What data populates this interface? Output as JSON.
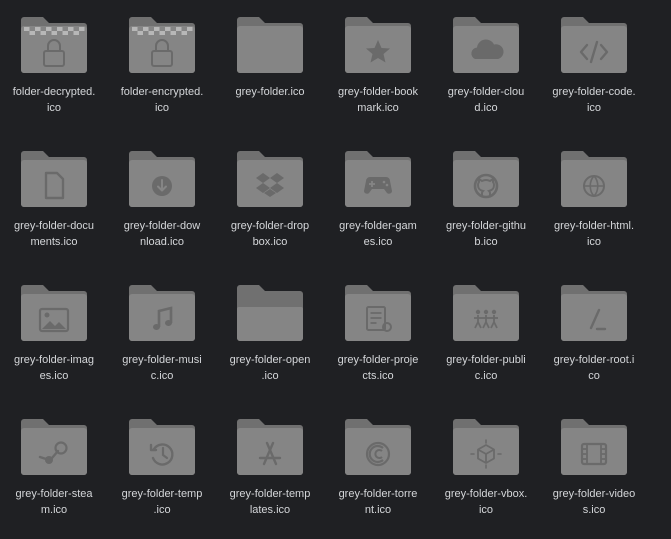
{
  "colors": {
    "background": "#1f2023",
    "text": "#d4d6d9",
    "folder_back": "#707070",
    "folder_front": "#858585",
    "glyph": "#6a6a6a"
  },
  "files": [
    {
      "name": "folder-decrypted.ico",
      "label_lines": [
        "folder-decrypted.",
        "ico"
      ],
      "icon": "decrypted-folder-icon"
    },
    {
      "name": "folder-encrypted.ico",
      "label_lines": [
        "folder-encrypted.",
        "ico"
      ],
      "icon": "encrypted-folder-icon"
    },
    {
      "name": "grey-folder.ico",
      "label_lines": [
        "grey-folder.ico"
      ],
      "icon": "folder-icon"
    },
    {
      "name": "grey-folder-bookmark.ico",
      "label_lines": [
        "grey-folder-book",
        "mark.ico"
      ],
      "icon": "bookmark-folder-icon"
    },
    {
      "name": "grey-folder-cloud.ico",
      "label_lines": [
        "grey-folder-clou",
        "d.ico"
      ],
      "icon": "cloud-folder-icon"
    },
    {
      "name": "grey-folder-code.ico",
      "label_lines": [
        "grey-folder-code.",
        "ico"
      ],
      "icon": "code-folder-icon"
    },
    {
      "name": "grey-folder-documents.ico",
      "label_lines": [
        "grey-folder-docu",
        "ments.ico"
      ],
      "icon": "documents-folder-icon"
    },
    {
      "name": "grey-folder-download.ico",
      "label_lines": [
        "grey-folder-dow",
        "nload.ico"
      ],
      "icon": "download-folder-icon"
    },
    {
      "name": "grey-folder-dropbox.ico",
      "label_lines": [
        "grey-folder-drop",
        "box.ico"
      ],
      "icon": "dropbox-folder-icon"
    },
    {
      "name": "grey-folder-games.ico",
      "label_lines": [
        "grey-folder-gam",
        "es.ico"
      ],
      "icon": "games-folder-icon"
    },
    {
      "name": "grey-folder-github.ico",
      "label_lines": [
        "grey-folder-githu",
        "b.ico"
      ],
      "icon": "github-folder-icon"
    },
    {
      "name": "grey-folder-html.ico",
      "label_lines": [
        "grey-folder-html.",
        "ico"
      ],
      "icon": "html-folder-icon"
    },
    {
      "name": "grey-folder-images.ico",
      "label_lines": [
        "grey-folder-imag",
        "es.ico"
      ],
      "icon": "images-folder-icon"
    },
    {
      "name": "grey-folder-music.ico",
      "label_lines": [
        "grey-folder-musi",
        "c.ico"
      ],
      "icon": "music-folder-icon"
    },
    {
      "name": "grey-folder-open.ico",
      "label_lines": [
        "grey-folder-open",
        ".ico"
      ],
      "icon": "open-folder-icon"
    },
    {
      "name": "grey-folder-projects.ico",
      "label_lines": [
        "grey-folder-proje",
        "cts.ico"
      ],
      "icon": "projects-folder-icon"
    },
    {
      "name": "grey-folder-public.ico",
      "label_lines": [
        "grey-folder-publi",
        "c.ico"
      ],
      "icon": "public-folder-icon"
    },
    {
      "name": "grey-folder-root.ico",
      "label_lines": [
        "grey-folder-root.i",
        "co"
      ],
      "icon": "root-folder-icon"
    },
    {
      "name": "grey-folder-steam.ico",
      "label_lines": [
        "grey-folder-stea",
        "m.ico"
      ],
      "icon": "steam-folder-icon"
    },
    {
      "name": "grey-folder-temp.ico",
      "label_lines": [
        "grey-folder-temp",
        ".ico"
      ],
      "icon": "temp-folder-icon"
    },
    {
      "name": "grey-folder-templates.ico",
      "label_lines": [
        "grey-folder-temp",
        "lates.ico"
      ],
      "icon": "templates-folder-icon"
    },
    {
      "name": "grey-folder-torrent.ico",
      "label_lines": [
        "grey-folder-torre",
        "nt.ico"
      ],
      "icon": "torrent-folder-icon"
    },
    {
      "name": "grey-folder-vbox.ico",
      "label_lines": [
        "grey-folder-vbox.",
        "ico"
      ],
      "icon": "vbox-folder-icon"
    },
    {
      "name": "grey-folder-videos.ico",
      "label_lines": [
        "grey-folder-video",
        "s.ico"
      ],
      "icon": "videos-folder-icon"
    }
  ]
}
